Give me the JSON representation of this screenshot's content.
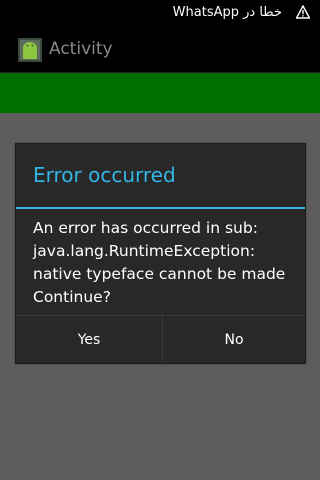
{
  "status_bar": {
    "notification_text": "WhatsApp خطا در",
    "icons": [
      "warning-icon"
    ]
  },
  "action_bar": {
    "title": "Activity",
    "icons": [
      "android-app-icon"
    ]
  },
  "dialog": {
    "title": "Error occurred",
    "message": "An error has occurred in sub:\njava.lang.RuntimeException:\nnative typeface cannot be made\nContinue?",
    "buttons": {
      "yes_label": "Yes",
      "no_label": "No"
    }
  },
  "colors": {
    "accent": "#33b5e5",
    "green_bar": "#006e00",
    "overlay": "#5d5d5d",
    "dialog_bg": "#282828"
  }
}
